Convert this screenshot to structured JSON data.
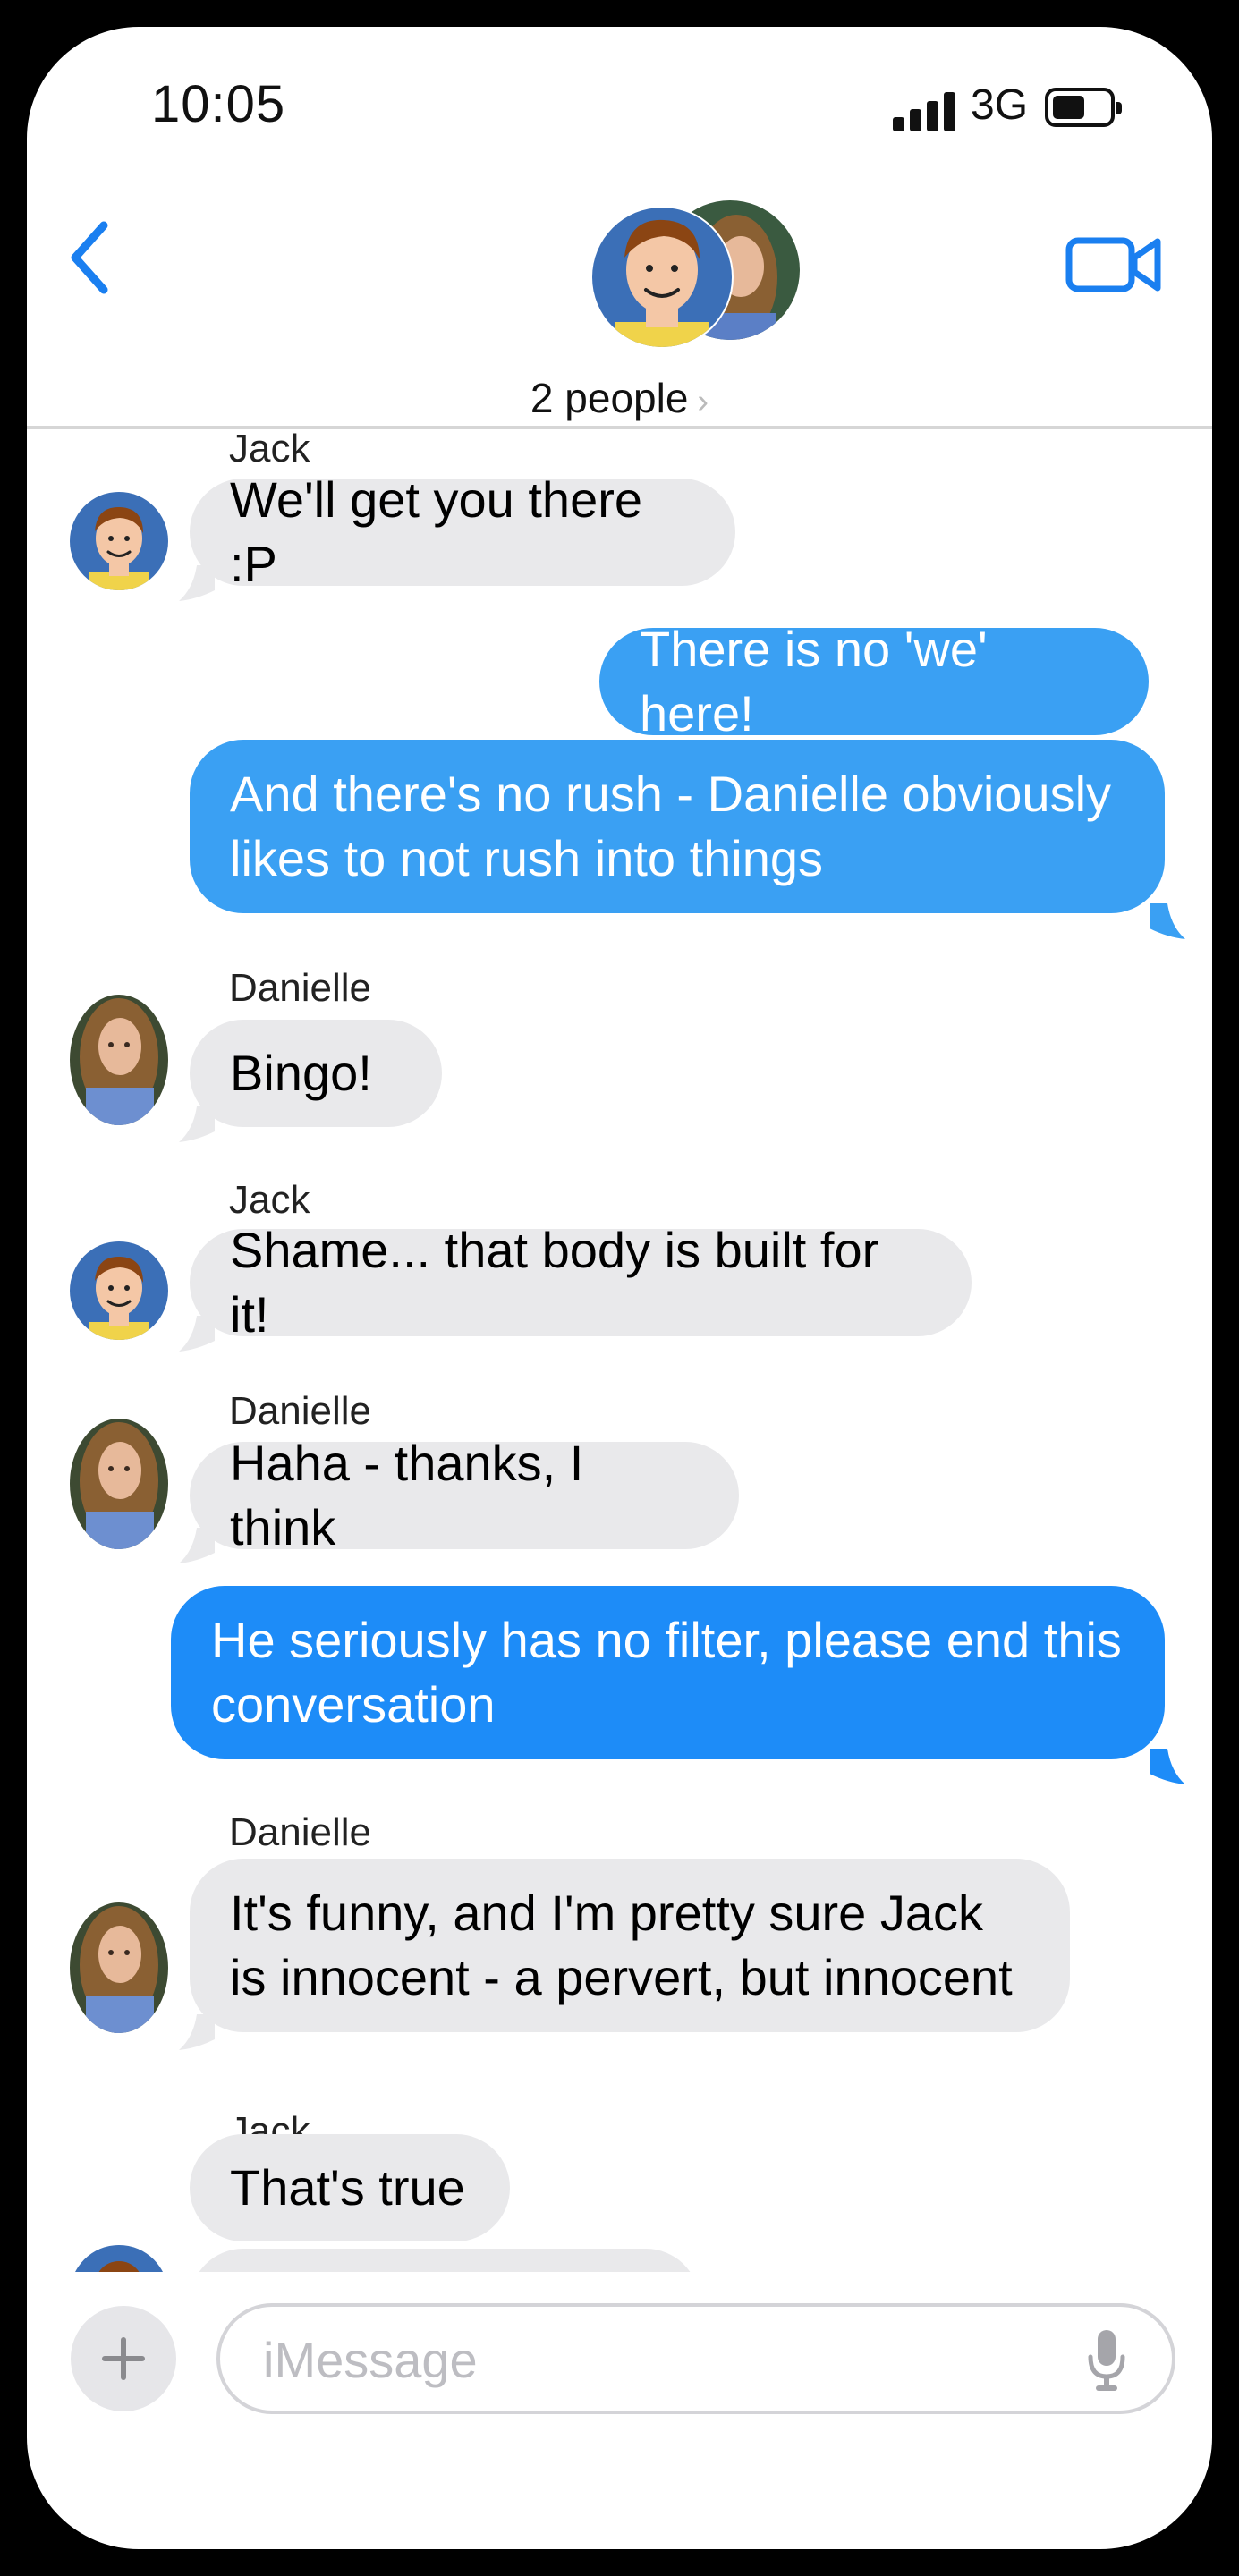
{
  "status_bar": {
    "time": "10:05",
    "network": "3G"
  },
  "header": {
    "people_label": "2 people",
    "chevron": "›"
  },
  "messages": [
    {
      "sender": "Jack",
      "text": "We'll get you there :P"
    },
    {
      "text": "There is no 'we' here!"
    },
    {
      "text": "And there's no rush - Danielle obviously likes to not rush into things"
    },
    {
      "sender": "Danielle",
      "text": "Bingo!"
    },
    {
      "sender": "Jack",
      "text": "Shame... that body is built for it!"
    },
    {
      "sender": "Danielle",
      "text": "Haha - thanks, I think"
    },
    {
      "text": "He seriously has no filter, please end this conversation"
    },
    {
      "sender": "Danielle",
      "text": "It's funny, and I'm pretty sure Jack is innocent - a pervert, but innocent"
    },
    {
      "sender": "Jack",
      "text": "That's true"
    }
  ],
  "composer": {
    "placeholder": "iMessage"
  },
  "colors": {
    "accent": "#1d8cf8",
    "sent_bubble": "#3aa0f3",
    "received_bubble": "#e9e9eb"
  },
  "icons": [
    "back-chevron-icon",
    "video-camera-icon",
    "plus-icon",
    "microphone-icon"
  ]
}
